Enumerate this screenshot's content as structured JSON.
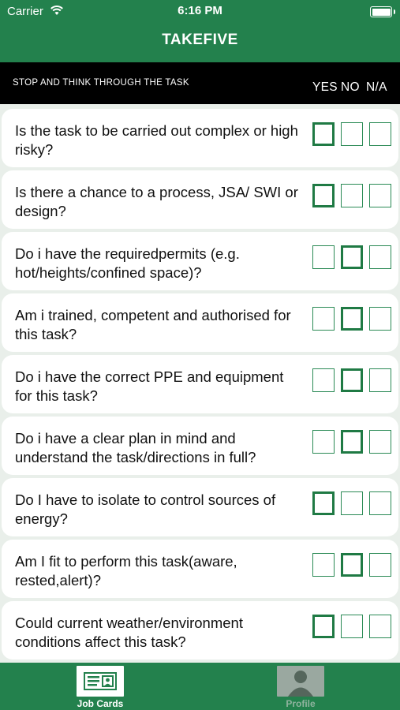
{
  "status_bar": {
    "carrier": "Carrier",
    "time": "6:16 PM"
  },
  "nav": {
    "title": "TAKEFIVE"
  },
  "header": {
    "label": "STOP AND THINK THROUGH THE TASK",
    "col_yes": "YES",
    "col_no": "NO",
    "col_na": "N/A"
  },
  "colors": {
    "brand_green": "#23814d",
    "list_background": "#e9efea",
    "checkbox_border": "#2a8a55"
  },
  "questions": [
    {
      "text": "Is the task to be carried out complex or high risky?",
      "selected": "yes"
    },
    {
      "text": "Is there a chance to a process, JSA/ SWI or design?",
      "selected": "yes"
    },
    {
      "text": "Do i have the requiredpermits (e.g. hot/heights/confined space)?",
      "selected": "no"
    },
    {
      "text": "Am i trained, competent and authorised for this task?",
      "selected": "no"
    },
    {
      "text": "Do i have the correct PPE and equipment for this task?",
      "selected": "no"
    },
    {
      "text": "Do i have a clear plan in mind and understand the task/directions in full?",
      "selected": "no"
    },
    {
      "text": "Do I have to isolate to control sources of energy?",
      "selected": "yes"
    },
    {
      "text": "Am I fit to perform this task(aware, rested,alert)?",
      "selected": "no"
    },
    {
      "text": "Could current weather/environment conditions affect this task?",
      "selected": "yes"
    }
  ],
  "tabbar": {
    "tabs": [
      {
        "label": "Job Cards",
        "icon": "job-cards-icon",
        "active": true
      },
      {
        "label": "Profile",
        "icon": "profile-icon",
        "active": false
      }
    ]
  }
}
